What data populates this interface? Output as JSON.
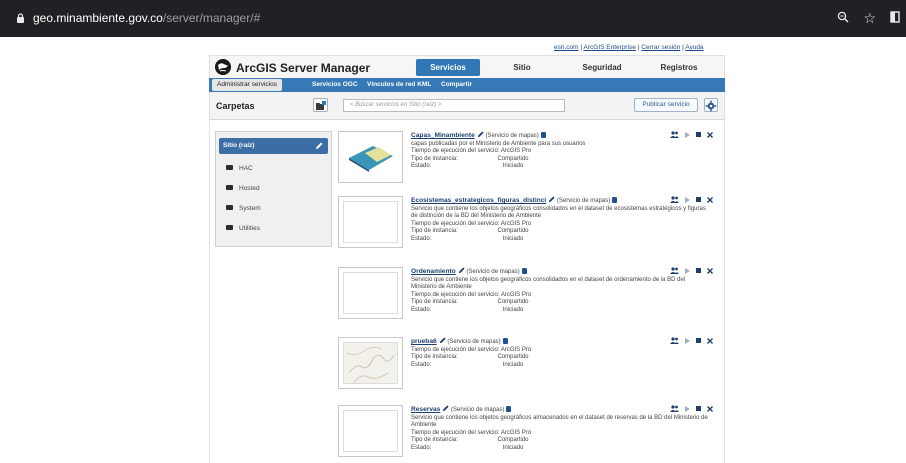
{
  "browser": {
    "domain": "geo.minambiente.gov.co",
    "path": "/server/manager/#"
  },
  "top_links": {
    "esri": "esri.com",
    "enterprise": "ArcGIS Enterprise",
    "logout": "Cerrar sesión",
    "help": "Ayuda",
    "separator": "|"
  },
  "header": {
    "title": "ArcGIS Server Manager",
    "tabs": [
      "Servicios",
      "Sitio",
      "Seguridad",
      "Registros"
    ]
  },
  "subnav": {
    "items": [
      "Administrar servicios",
      "Servicios OGC",
      "Vínculos de red KML",
      "Compartir"
    ]
  },
  "toolbar": {
    "folders_label": "Carpetas",
    "search_placeholder": "< Buscar servicios en Sitio (raíz) >",
    "publish_label": "Publicar servicio"
  },
  "sidebar": {
    "root": "Sitio (raíz)",
    "folders": [
      "HAC",
      "Hosted",
      "System",
      "Utilities"
    ]
  },
  "labels": {
    "runtime": "Tiempo de ejecución del servicio: ArcGIS Pro",
    "instance": "Tipo de instancia:",
    "instance_val": "Compartido",
    "state": "Estado:",
    "state_val": "Iniciado",
    "type": "(Servicio de mapas)"
  },
  "services": [
    {
      "name": "Capas_Minambiente",
      "desc": "capas publicadas por el Ministerio de Ambiente para sus usuarios"
    },
    {
      "name": "Ecosistemas_estrategicos_figuras_distinci",
      "desc": "Servicio que contiene los objetos geográficos consolidados en el dataset de ecosistemas estratégicos y figuras de distinción de la BD del Ministerio de Ambiente"
    },
    {
      "name": "Ordenamiento",
      "desc": "Servicio que contiene los objetos geográficos consolidados en el dataset de ordenamiento de la BD del Ministerio de Ambiente"
    },
    {
      "name": "prueba6",
      "desc": ""
    },
    {
      "name": "Reservas",
      "desc": "Servicio que contiene los objetos geográficos almacenados en el dataset de reservas de la BD del Ministerio de Ambiente"
    }
  ],
  "colors": {
    "accent": "#2f77b5",
    "subnav": "#3679b6",
    "link": "#1b3f70"
  }
}
